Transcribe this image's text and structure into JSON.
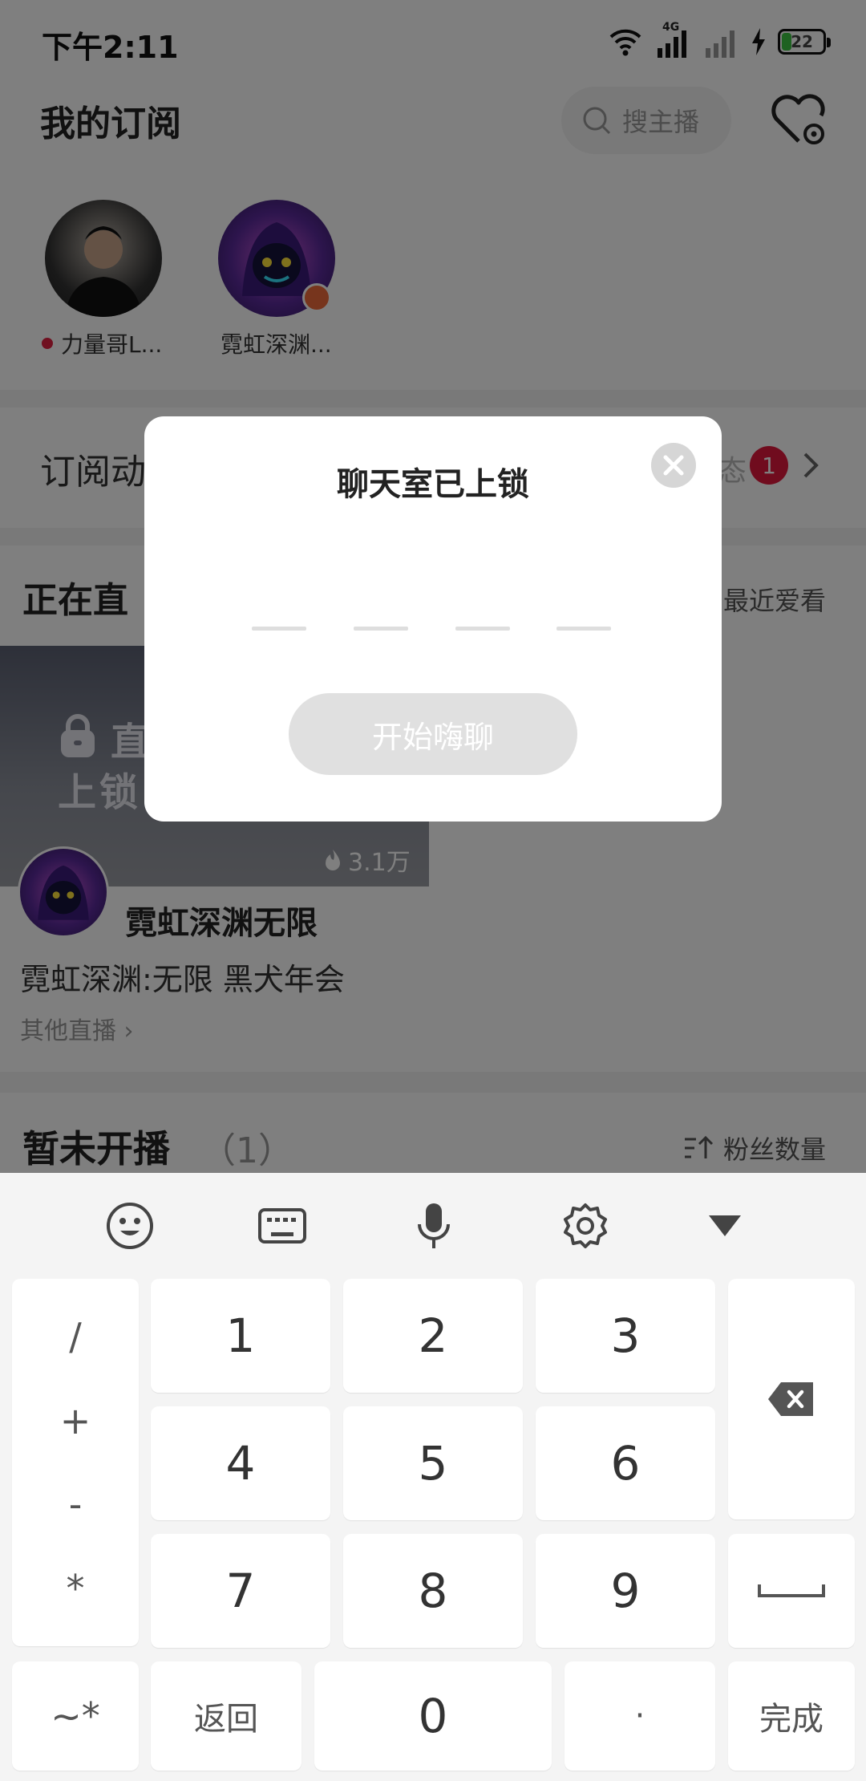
{
  "status_bar": {
    "time": "下午2:11",
    "network": "4G",
    "battery": "22"
  },
  "header": {
    "title": "我的订阅",
    "search_placeholder": "搜主播"
  },
  "subscriptions": [
    {
      "name": "力量哥L...",
      "live": true
    },
    {
      "name": "霓虹深渊...",
      "live": false
    }
  ],
  "feed": {
    "label": "订阅动",
    "tail": "态",
    "badge": "1"
  },
  "live_section": {
    "title": "正在直",
    "sort": "最近爱看"
  },
  "live_card": {
    "overlay_line1": "直",
    "overlay_line2": "上锁",
    "heat": "3.1万",
    "host": "霓虹深渊无限",
    "desc": "霓虹深渊:无限 黑犬年会",
    "more": "其他直播 ›"
  },
  "not_live": {
    "title": "暂未开播",
    "count": "（1）",
    "sort": "粉丝数量"
  },
  "dialog": {
    "title": "聊天室已上锁",
    "button": "开始嗨聊"
  },
  "keyboard": {
    "symbols": [
      "/",
      "+",
      "-",
      "*"
    ],
    "digits": [
      "1",
      "2",
      "3",
      "4",
      "5",
      "6",
      "7",
      "8",
      "9"
    ],
    "tilde": "~*",
    "back": "返回",
    "zero": "0",
    "dot": "·",
    "done": "完成"
  },
  "colors": {
    "badge_red": "#e0183c",
    "overlay": "rgba(0,0,0,0.5)",
    "button_disabled": "#e0e0e0"
  }
}
